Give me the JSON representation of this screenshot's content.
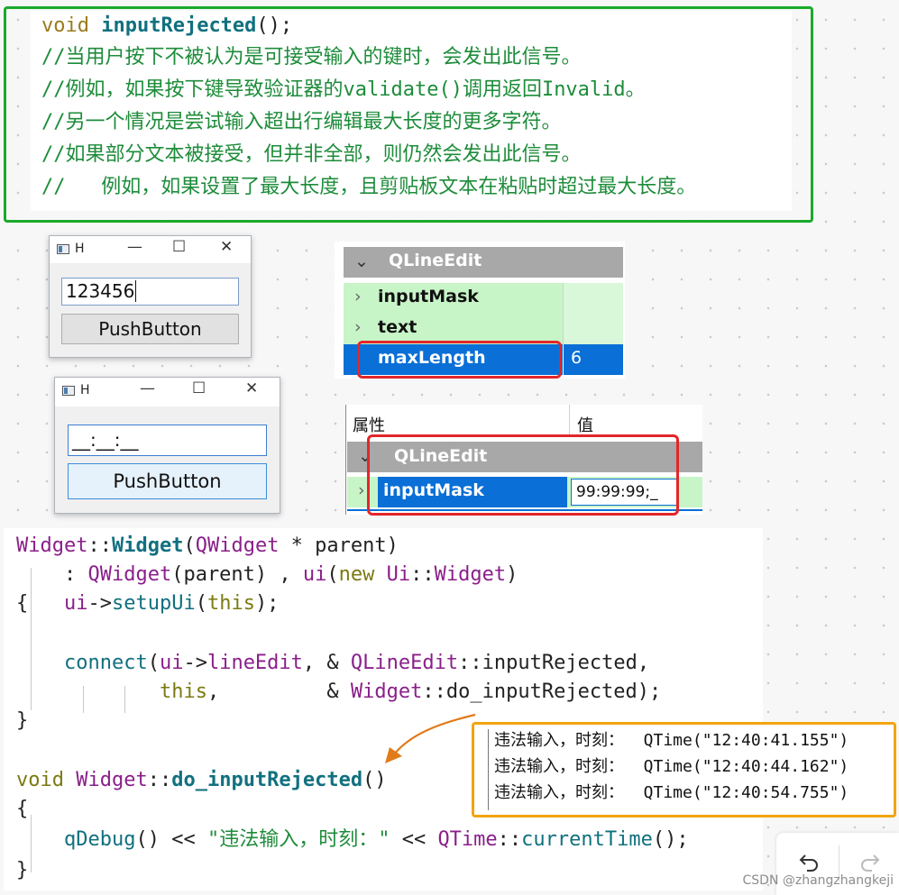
{
  "top_code": {
    "lines": [
      {
        "a": "void",
        "b": " ",
        "c": "inputRejected",
        "d": "();"
      },
      {
        "text": "//当用户按下不被认为是可接受输入的键时，会发出此信号。"
      },
      {
        "text": "//例如，如果按下键导致验证器的validate()调用返回Invalid。"
      },
      {
        "text": "//另一个情况是尝试输入超出行编辑最大长度的更多字符。"
      },
      {
        "text": "//如果部分文本被接受，但并非全部，则仍然会发出此信号。"
      },
      {
        "text": "//   例如，如果设置了最大长度，且剪贴板文本在粘贴时超过最大长度。"
      }
    ],
    "border_color": "#1aaa2a"
  },
  "window1": {
    "title": "H",
    "minimize": "—",
    "maximize": "☐",
    "close": "✕",
    "lineedit_value": "123456",
    "button_label": "PushButton"
  },
  "window2": {
    "title": "H",
    "minimize": "—",
    "maximize": "☐",
    "close": "✕",
    "lineedit_value": "__:__:__",
    "button_label": "PushButton"
  },
  "prop_panel1": {
    "group": "QLineEdit",
    "rows": [
      {
        "name": "inputMask",
        "value": ""
      },
      {
        "name": "text",
        "value": ""
      },
      {
        "name": "maxLength",
        "value": "6"
      }
    ]
  },
  "prop_panel2": {
    "header_prop": "属性",
    "header_value": "值",
    "group": "QLineEdit",
    "row_name": "inputMask",
    "row_value": "99:99:99;_"
  },
  "bottom_code": {
    "l1": {
      "a": "Widget",
      "b": "::",
      "c": "Widget",
      "d": "(",
      "e": "QWidget",
      "f": " * parent)"
    },
    "l2": {
      "a": "    : ",
      "b": "QWidget",
      "c": "(parent) , ",
      "d": "ui",
      "e": "(",
      "f": "new",
      "g": " ",
      "h": "Ui",
      "i": "::",
      "j": "Widget",
      "k": ")"
    },
    "l3": {
      "a": "{   ",
      "b": "ui",
      "c": "->",
      "d": "setupUi",
      "e": "(",
      "f": "this",
      "g": ");"
    },
    "l5": {
      "a": "    ",
      "b": "connect",
      "c": "(",
      "d": "ui",
      "e": "->",
      "f": "lineEdit",
      "g": ", & ",
      "h": "QLineEdit",
      "i": "::",
      "j": "inputRejected",
      "k": ","
    },
    "l6": {
      "a": "            ",
      "b": "this",
      "c": ",         & ",
      "d": "Widget",
      "e": "::",
      "f": "do_inputRejected",
      "g": ");"
    },
    "l7": {
      "a": "}"
    },
    "l9": {
      "a": "void",
      "b": " ",
      "c": "Widget",
      "d": "::",
      "e": "do_inputRejected",
      "f": "()"
    },
    "l10": {
      "a": "{"
    },
    "l11": {
      "a": "    ",
      "b": "qDebug",
      "c": "() << ",
      "d": "\"违法输入，时刻：\"",
      "e": " << ",
      "f": "QTime",
      "g": "::",
      "h": "currentTime",
      "i": "();"
    },
    "l12": {
      "a": "}"
    }
  },
  "debug_output": {
    "lines": [
      "违法输入，时刻：  QTime(\"12:40:41.155\")",
      "违法输入，时刻：  QTime(\"12:40:44.162\")",
      "违法输入，时刻：  QTime(\"12:40:54.755\")"
    ],
    "border_color": "#f2a50f"
  },
  "toolbar": {
    "undo_icon": "undo-icon",
    "redo_icon": "redo-icon"
  },
  "watermark": "CSDN @zhangzhangkeji",
  "colors": {
    "highlight": "#0a6fd6",
    "prop_green": "#c8f5c8",
    "group_header": "#a8a8a8",
    "red_box": "#e3262a",
    "arrow": "#e07b1a"
  }
}
